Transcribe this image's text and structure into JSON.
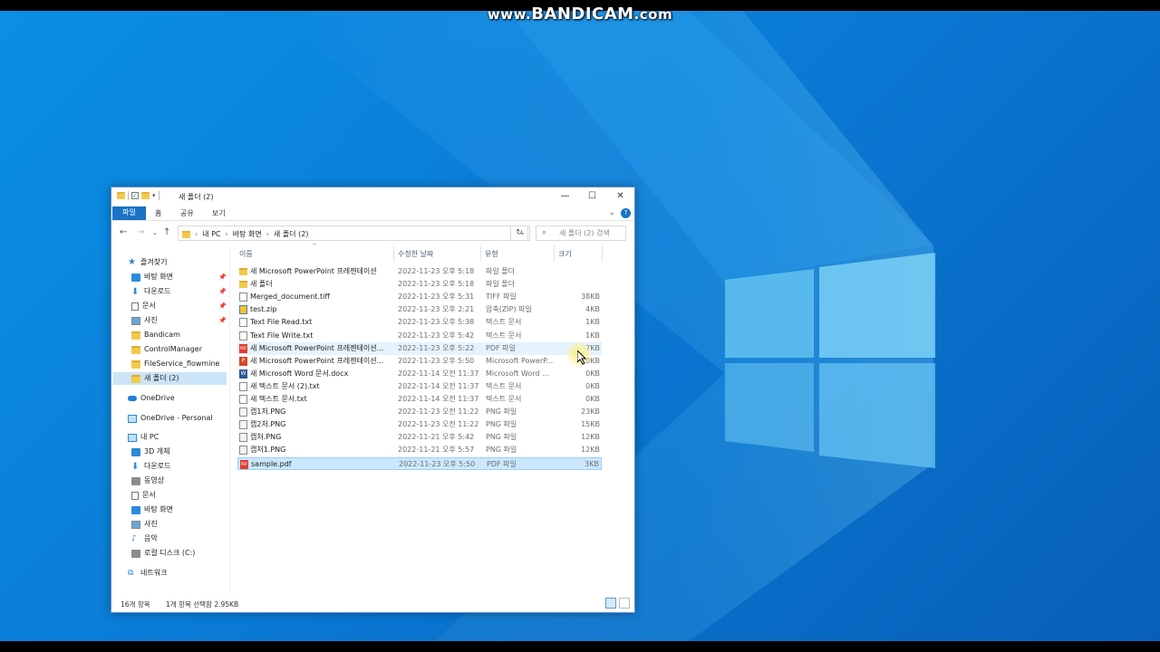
{
  "watermark": {
    "prefix": "www.",
    "brand": "BANDICAM",
    "suffix": ".com"
  },
  "window": {
    "title": "새 폴더 (2)",
    "controls": {
      "minimize": "—",
      "maximize": "☐",
      "close": "✕"
    }
  },
  "ribbon": {
    "tabs": [
      "파일",
      "홈",
      "공유",
      "보기"
    ]
  },
  "address": {
    "crumbs": [
      "내 PC",
      "바탕 화면",
      "새 폴더 (2)"
    ],
    "search_placeholder": "새 폴더 (2) 검색"
  },
  "sidebar": {
    "items": [
      {
        "label": "즐겨찾기",
        "icon": "star-icon"
      },
      {
        "label": "바탕 화면",
        "icon": "desktop-icon",
        "pinned": true
      },
      {
        "label": "다운로드",
        "icon": "download-icon",
        "pinned": true
      },
      {
        "label": "문서",
        "icon": "document-icon",
        "pinned": true
      },
      {
        "label": "사진",
        "icon": "picture-icon",
        "pinned": true
      },
      {
        "label": "Bandicam",
        "icon": "folder-icon"
      },
      {
        "label": "ControlManager",
        "icon": "folder-icon"
      },
      {
        "label": "FileService_flowmine",
        "icon": "folder-icon"
      },
      {
        "label": "새 폴더 (2)",
        "icon": "folder-icon",
        "selected": true
      },
      {
        "label": "OneDrive",
        "icon": "cloud-icon"
      },
      {
        "label": "OneDrive - Personal",
        "icon": "cloud-icon"
      },
      {
        "label": "내 PC",
        "icon": "pc-icon"
      },
      {
        "label": "3D 개체",
        "icon": "3d-objects-icon"
      },
      {
        "label": "다운로드",
        "icon": "download-icon"
      },
      {
        "label": "동영상",
        "icon": "video-icon"
      },
      {
        "label": "문서",
        "icon": "document-icon"
      },
      {
        "label": "바탕 화면",
        "icon": "desktop-icon"
      },
      {
        "label": "사진",
        "icon": "picture-icon"
      },
      {
        "label": "음악",
        "icon": "music-icon"
      },
      {
        "label": "로컬 디스크 (C:)",
        "icon": "disk-icon"
      },
      {
        "label": "네트워크",
        "icon": "network-icon"
      }
    ]
  },
  "columns": {
    "name": "이름",
    "date": "수정한 날짜",
    "type": "유형",
    "size": "크기"
  },
  "files": [
    {
      "name": "새 Microsoft PowerPoint 프레젠테이션",
      "date": "2022-11-23 오후 5:18",
      "type": "파일 폴더",
      "size": "",
      "kind": "folder"
    },
    {
      "name": "새 폴더",
      "date": "2022-11-23 오후 5:18",
      "type": "파일 폴더",
      "size": "",
      "kind": "folder"
    },
    {
      "name": "Merged_document.tiff",
      "date": "2022-11-23 오후 5:31",
      "type": "TIFF 파일",
      "size": "38KB",
      "kind": "tiff"
    },
    {
      "name": "test.zip",
      "date": "2022-11-23 오후 2:21",
      "type": "압축(ZIP) 파일",
      "size": "4KB",
      "kind": "zip"
    },
    {
      "name": "Text File Read.txt",
      "date": "2022-11-23 오후 5:38",
      "type": "텍스트 문서",
      "size": "1KB",
      "kind": "txt"
    },
    {
      "name": "Text File Write.txt",
      "date": "2022-11-23 오후 5:42",
      "type": "텍스트 문서",
      "size": "1KB",
      "kind": "txt"
    },
    {
      "name": "새 Microsoft PowerPoint 프레젠테이션...",
      "date": "2022-11-23 오후 5:22",
      "type": "PDF 파일",
      "size": "7KB",
      "kind": "pdf",
      "hover": true
    },
    {
      "name": "새 Microsoft PowerPoint 프레젠테이션...",
      "date": "2022-11-23 오후 5:50",
      "type": "Microsoft PowerP...",
      "size": "0KB",
      "kind": "ppt"
    },
    {
      "name": "새 Microsoft Word 문서.docx",
      "date": "2022-11-14 오전 11:37",
      "type": "Microsoft Word ...",
      "size": "0KB",
      "kind": "word"
    },
    {
      "name": "새 텍스트 문서 (2).txt",
      "date": "2022-11-14 오전 11:37",
      "type": "텍스트 문서",
      "size": "0KB",
      "kind": "txt"
    },
    {
      "name": "새 텍스트 문서.txt",
      "date": "2022-11-14 오전 11:37",
      "type": "텍스트 문서",
      "size": "0KB",
      "kind": "txt"
    },
    {
      "name": "캡1처.PNG",
      "date": "2022-11-23 오전 11:22",
      "type": "PNG 파일",
      "size": "23KB",
      "kind": "png"
    },
    {
      "name": "캡2처.PNG",
      "date": "2022-11-23 오전 11:22",
      "type": "PNG 파일",
      "size": "15KB",
      "kind": "png"
    },
    {
      "name": "캡처.PNG",
      "date": "2022-11-21 오후 5:42",
      "type": "PNG 파일",
      "size": "12KB",
      "kind": "png"
    },
    {
      "name": "캡처1.PNG",
      "date": "2022-11-21 오후 5:57",
      "type": "PNG 파일",
      "size": "12KB",
      "kind": "png"
    },
    {
      "name": "sample.pdf",
      "date": "2022-11-23 오후 5:50",
      "type": "PDF 파일",
      "size": "3KB",
      "kind": "pdf",
      "selected": true
    }
  ],
  "status": {
    "count": "16개 항목",
    "selection": "1개 항목 선택함 2.95KB"
  },
  "colors": {
    "accent": "#1a73c6",
    "selection": "#cce8ff",
    "desktop": "#0a7bd6"
  }
}
